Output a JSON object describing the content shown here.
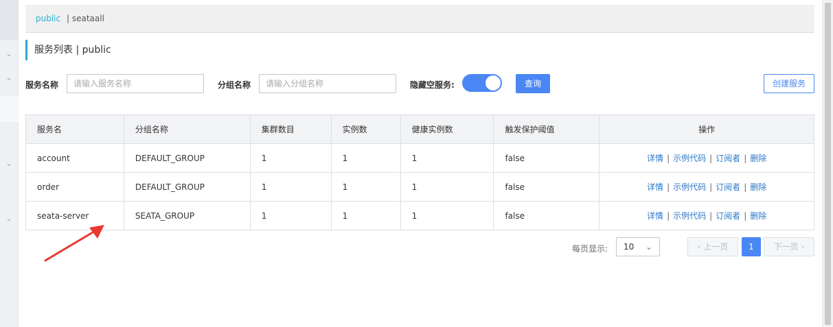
{
  "namespaces": {
    "active": "public",
    "other": "|  seataall"
  },
  "page_title": "服务列表 | public",
  "filters": {
    "service_name_label": "服务名称",
    "service_name_placeholder": "请输入服务名称",
    "group_name_label": "分组名称",
    "group_name_placeholder": "请输入分组名称",
    "hide_empty_label": "隐藏空服务:",
    "hide_empty_on": true,
    "query_button": "查询",
    "create_button": "创建服务"
  },
  "table": {
    "headers": [
      "服务名",
      "分组名称",
      "集群数目",
      "实例数",
      "健康实例数",
      "触发保护阈值",
      "操作"
    ],
    "rows": [
      [
        "account",
        "DEFAULT_GROUP",
        "1",
        "1",
        "1",
        "false"
      ],
      [
        "order",
        "DEFAULT_GROUP",
        "1",
        "1",
        "1",
        "false"
      ],
      [
        "seata-server",
        "SEATA_GROUP",
        "1",
        "1",
        "1",
        "false"
      ]
    ],
    "actions": [
      "详情",
      "示例代码",
      "订阅者",
      "删除"
    ],
    "action_sep": "|"
  },
  "pagination": {
    "page_size_label": "每页显示:",
    "page_size": "10",
    "prev": "上一页",
    "next": "下一页",
    "current_page": "1"
  },
  "colors": {
    "accent": "#4a87f5",
    "link": "#2977c9",
    "ns_active": "#24b0d3",
    "annotation_arrow": "#e8392f"
  },
  "icons": {
    "rail": "chevron-down-icon",
    "select": "chevron-down-icon",
    "prev": "chevron-left-icon",
    "next": "chevron-right-icon"
  }
}
